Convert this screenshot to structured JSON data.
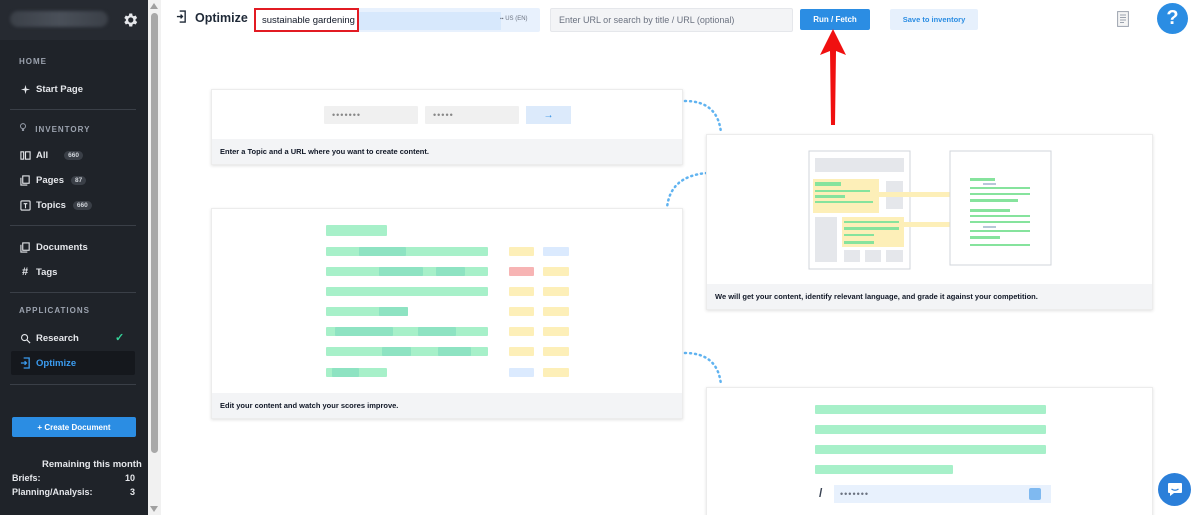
{
  "sidebar": {
    "sections": {
      "home": "HOME",
      "inventory": "INVENTORY",
      "applications": "APPLICATIONS"
    },
    "items": {
      "start_page": "Start Page",
      "all": "All",
      "all_count": "660",
      "pages": "Pages",
      "pages_count": "87",
      "topics": "Topics",
      "topics_count": "660",
      "documents": "Documents",
      "tags": "Tags",
      "research": "Research",
      "optimize": "Optimize"
    },
    "create_button": "+ Create Document",
    "remaining_title": "Remaining this month",
    "quota": [
      {
        "label": "Briefs:",
        "value": "10"
      },
      {
        "label": "Planning/Analysis:",
        "value": "3"
      }
    ]
  },
  "topbar": {
    "title": "Optimize",
    "topic_value": "sustainable gardening",
    "locale": "US (EN)",
    "url_placeholder": "Enter URL or search by title / URL (optional)",
    "run_label": "Run / Fetch",
    "save_label": "Save to inventory",
    "help_label": "?"
  },
  "cards": {
    "step1_caption": "Enter a Topic and a URL where you want to create content.",
    "step1_field1": "•••••••",
    "step1_field2": "•••••",
    "step1_arrow": "→",
    "step2_caption": "We will get your content, identify relevant language, and grade it against your competition.",
    "step3_caption": "Edit your content and watch your scores improve.",
    "step4_slash": "/",
    "step4_field": "•••••••"
  },
  "colors": {
    "accent": "#2b8de3",
    "highlight": "#e21b23",
    "sidebar_bg": "#1f2329"
  }
}
